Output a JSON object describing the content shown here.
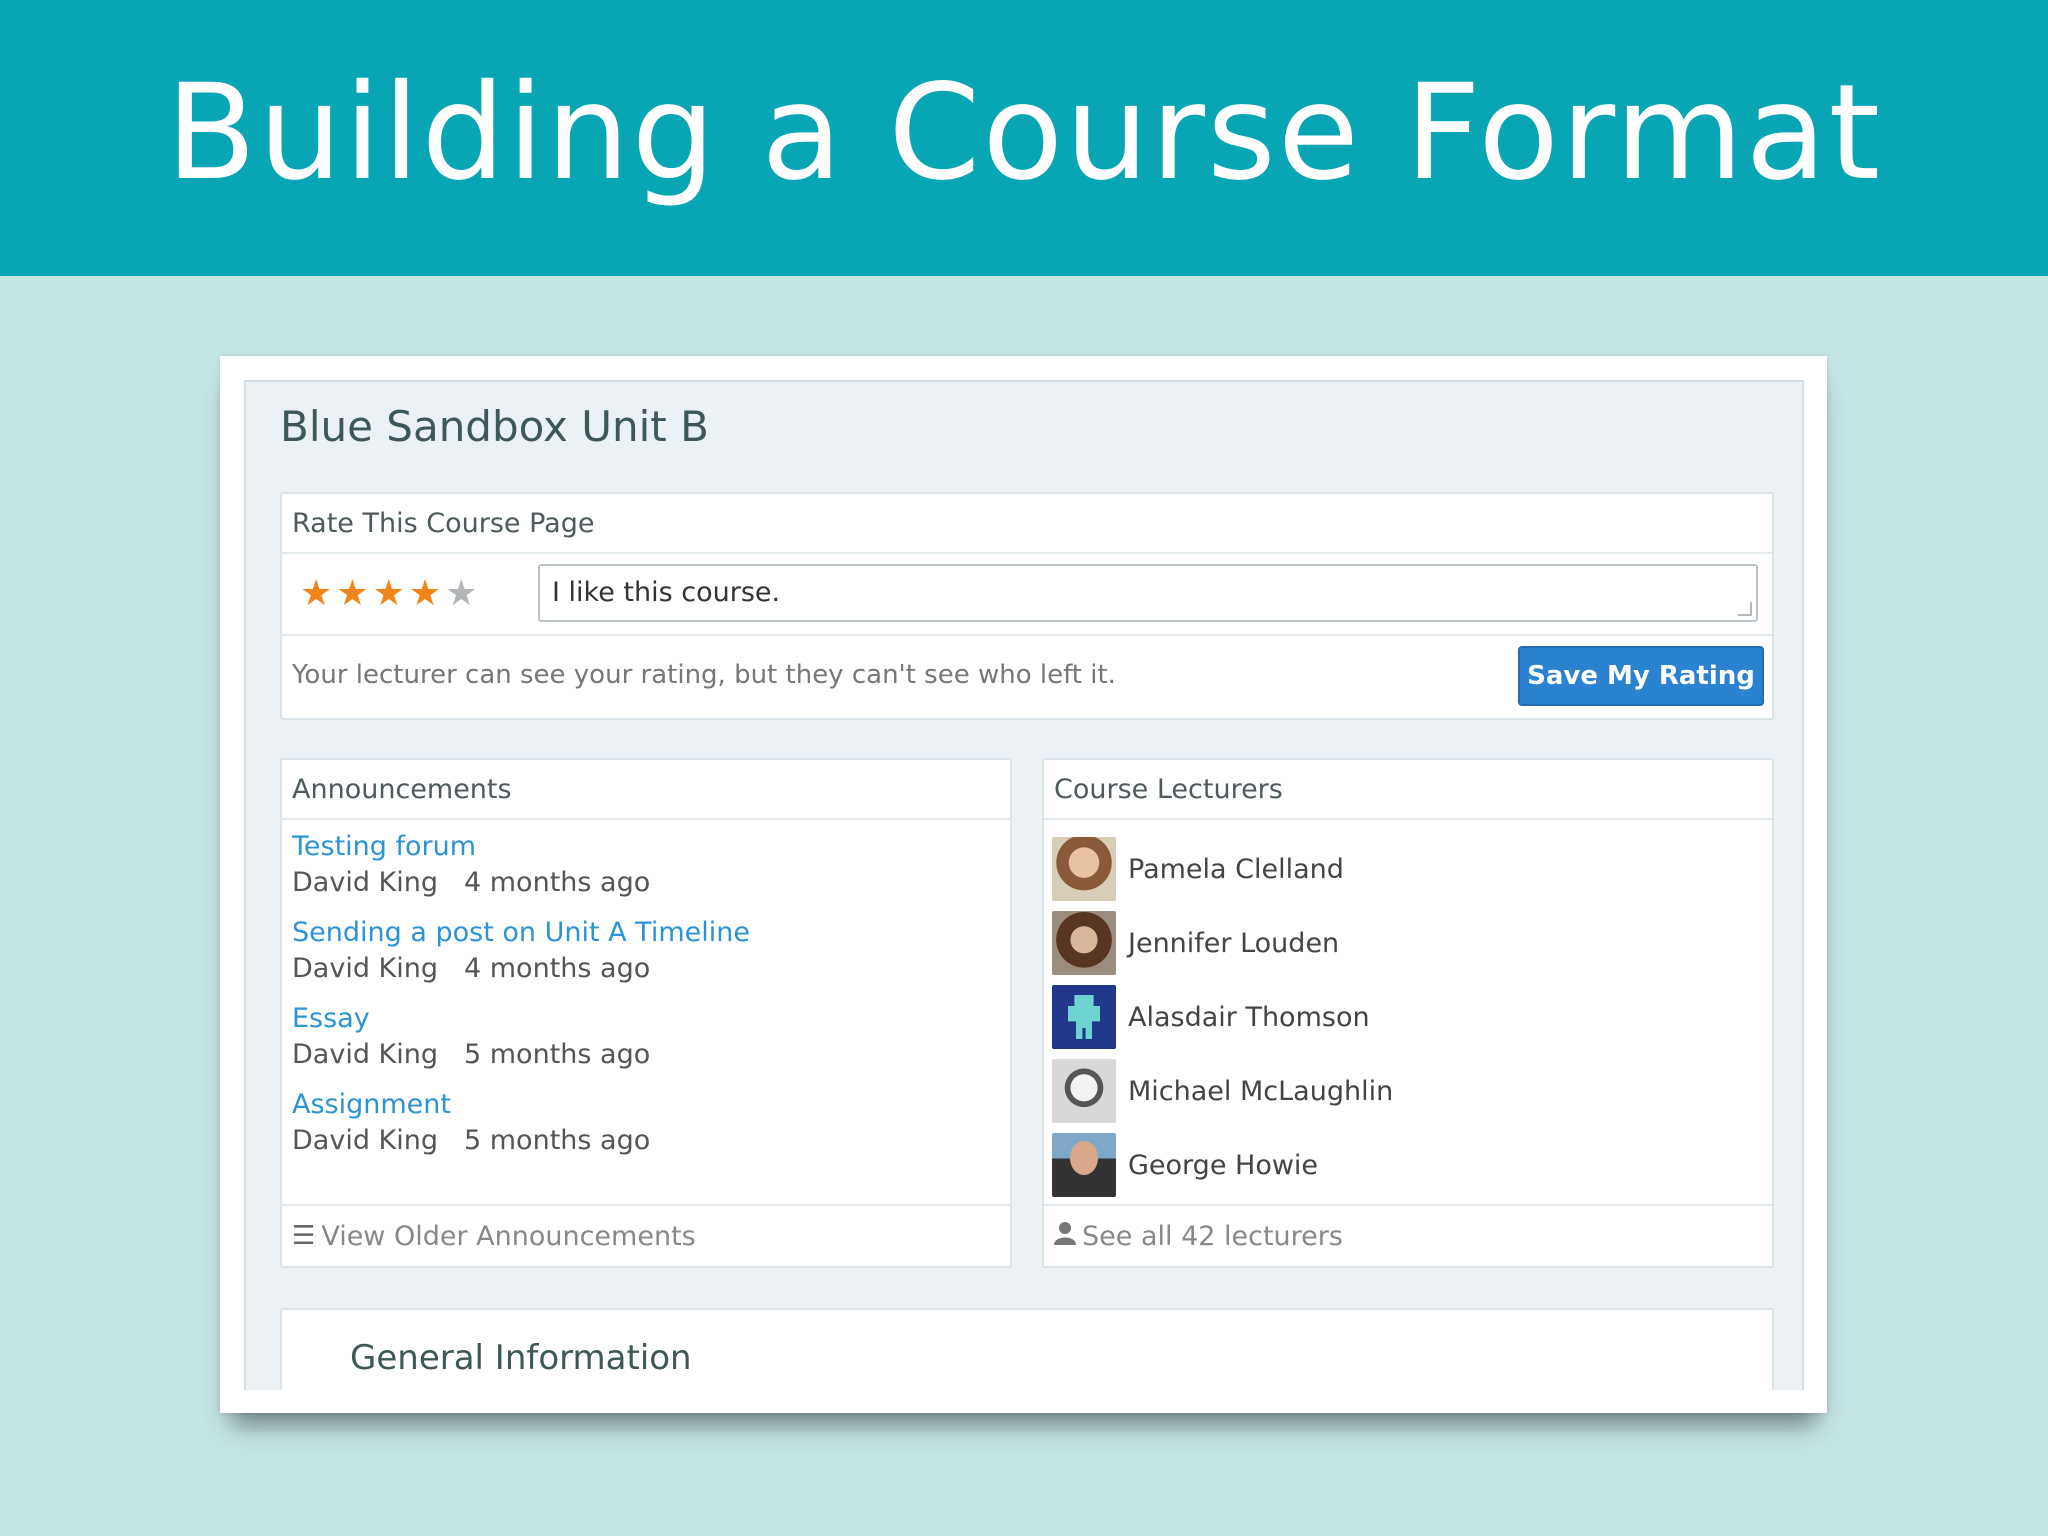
{
  "slide": {
    "title": "Building a Course Format"
  },
  "course": {
    "title": "Blue Sandbox Unit B"
  },
  "rating": {
    "heading": "Rate This Course Page",
    "stars_filled": 4,
    "stars_total": 5,
    "comment": "I like this course.",
    "note": "Your lecturer can see your rating, but they can't see who left it.",
    "save_label": "Save My Rating",
    "colors": {
      "star_on": "#f18519",
      "star_off": "#b3b6b8",
      "button": "#2a82d1"
    }
  },
  "announcements": {
    "heading": "Announcements",
    "items": [
      {
        "title": "Testing forum",
        "author": "David King",
        "time": "4 months ago"
      },
      {
        "title": "Sending a post on Unit A Timeline",
        "author": "David King",
        "time": "4 months ago"
      },
      {
        "title": "Essay",
        "author": "David King",
        "time": "5 months ago"
      },
      {
        "title": "Assignment",
        "author": "David King",
        "time": "5 months ago"
      }
    ],
    "footer_icon": "list-icon",
    "footer": "View Older Announcements"
  },
  "lecturers": {
    "heading": "Course Lecturers",
    "items": [
      {
        "name": "Pamela Clelland"
      },
      {
        "name": "Jennifer Louden"
      },
      {
        "name": "Alasdair Thomson"
      },
      {
        "name": "Michael McLaughlin"
      },
      {
        "name": "George Howie"
      }
    ],
    "footer_icon": "user-icon",
    "footer": "See all 42 lecturers"
  },
  "general": {
    "title": "General Information"
  }
}
